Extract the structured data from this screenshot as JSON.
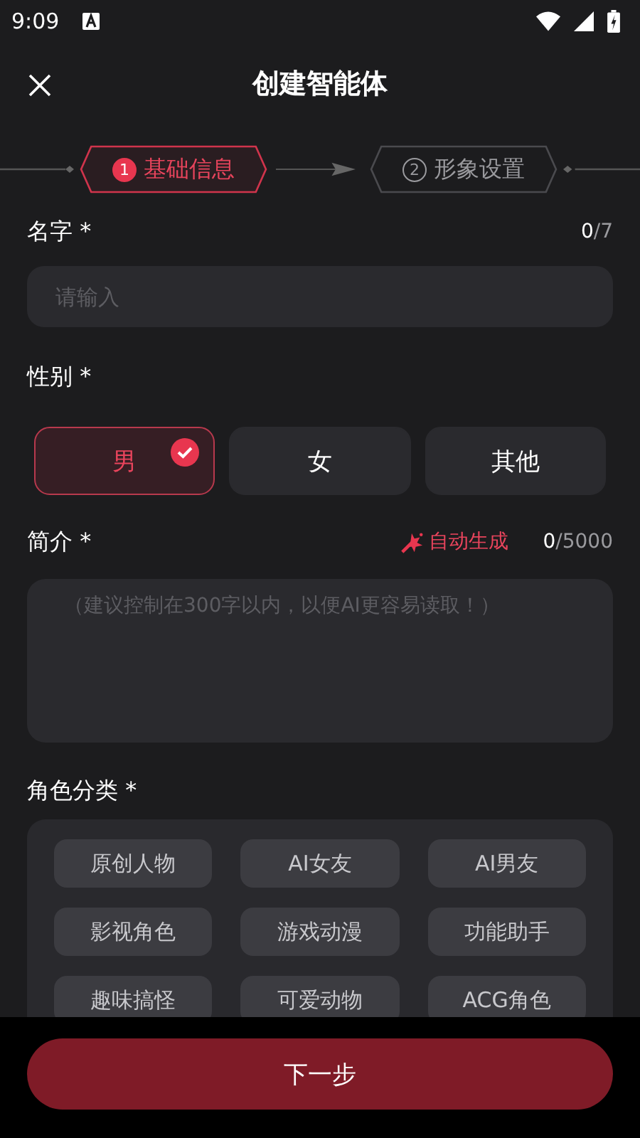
{
  "status_bar": {
    "time": "9:09"
  },
  "header": {
    "title": "创建智能体"
  },
  "steps": [
    {
      "number": "1",
      "label": "基础信息",
      "selected": true
    },
    {
      "number": "2",
      "label": "形象设置",
      "selected": false
    }
  ],
  "name_field": {
    "label": "名字",
    "required": "*",
    "count": "0",
    "limit": "/7",
    "placeholder": "请输入"
  },
  "gender": {
    "label": "性别",
    "required": "*",
    "options": [
      {
        "label": "男",
        "selected": true
      },
      {
        "label": "女",
        "selected": false
      },
      {
        "label": "其他",
        "selected": false
      }
    ]
  },
  "intro": {
    "label": "简介",
    "required": "*",
    "auto_generate": "自动生成",
    "count": "0",
    "limit": "/5000",
    "placeholder": "（建议控制在300字以内，以便AI更容易读取！）"
  },
  "category": {
    "label": "角色分类",
    "required": "*",
    "options": [
      {
        "label": "原创人物",
        "selected": false
      },
      {
        "label": "AI女友",
        "selected": false
      },
      {
        "label": "AI男友",
        "selected": false
      },
      {
        "label": "影视角色",
        "selected": false
      },
      {
        "label": "游戏动漫",
        "selected": false
      },
      {
        "label": "功能助手",
        "selected": false
      },
      {
        "label": "趣味搞怪",
        "selected": false
      },
      {
        "label": "可爱动物",
        "selected": false
      },
      {
        "label": "ACG角色",
        "selected": false
      }
    ]
  },
  "next_button": {
    "label": "下一步"
  }
}
